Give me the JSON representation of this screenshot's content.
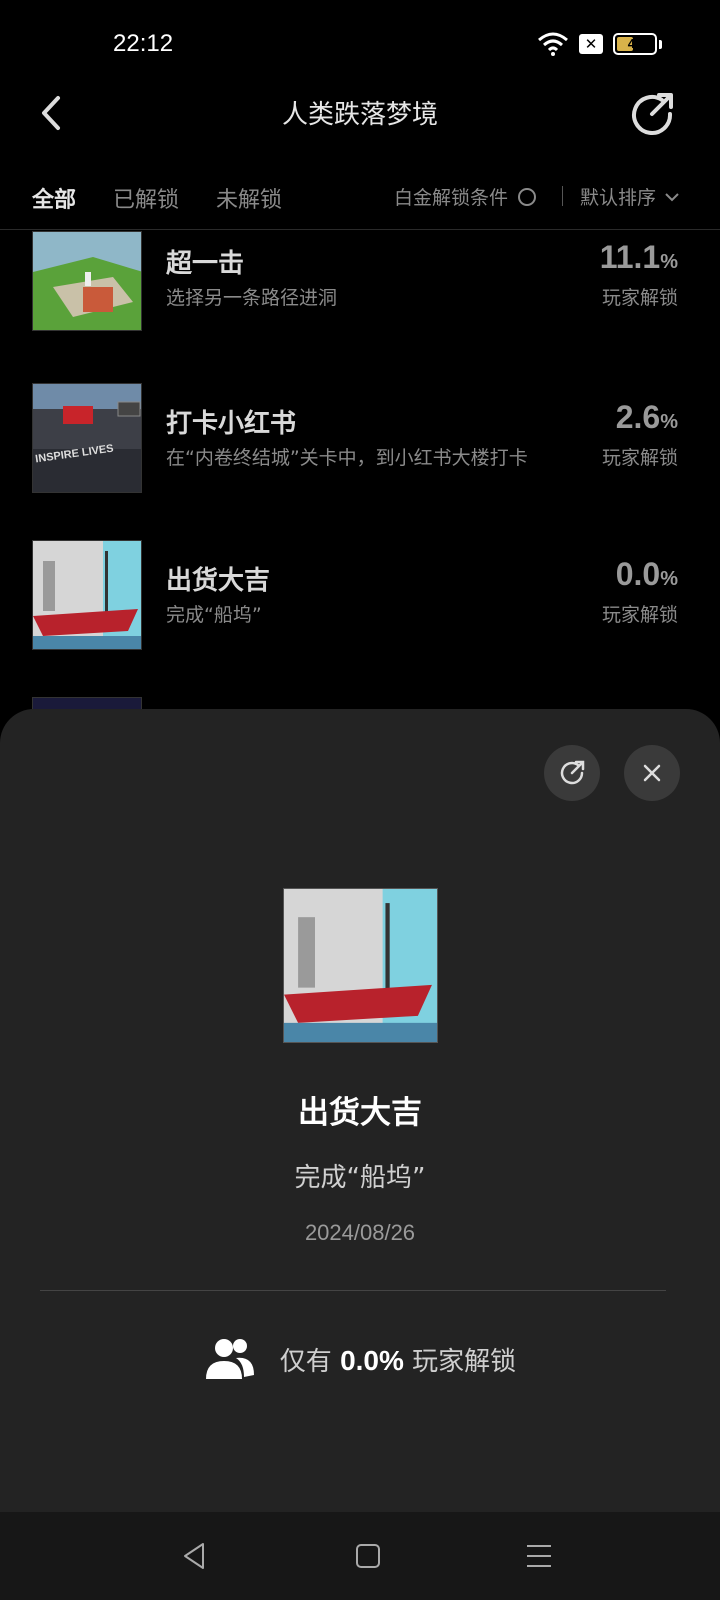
{
  "status": {
    "time": "22:12",
    "battery": "44",
    "battery_level": 0.44
  },
  "header": {
    "title": "人类跌落梦境"
  },
  "tabs": [
    {
      "label": "全部",
      "active": true
    },
    {
      "label": "已解锁",
      "active": false
    },
    {
      "label": "未解锁",
      "active": false
    }
  ],
  "filters": {
    "platinum": "白金解锁条件",
    "sort": "默认排序"
  },
  "achievements": [
    {
      "title": "超一击",
      "desc": "选择另一条路径进洞",
      "pct": "11.1",
      "pct_unit": "%",
      "sub": "玩家解锁"
    },
    {
      "title": "打卡小红书",
      "desc": "在“内卷终结城”关卡中，到小红书大楼打卡",
      "pct": "2.6",
      "pct_unit": "%",
      "sub": "玩家解锁",
      "thumb_text": "INSPIRE LIVES"
    },
    {
      "title": "出货大吉",
      "desc": "完成“船坞”",
      "pct": "0.0",
      "pct_unit": "%",
      "sub": "玩家解锁"
    }
  ],
  "detail": {
    "title": "出货大吉",
    "desc": "完成“船坞”",
    "date": "2024/08/26",
    "rarity_prefix": "仅有",
    "rarity_value": "0.0%",
    "rarity_suffix": "玩家解锁"
  },
  "colors": {
    "background": "#000000",
    "sheet": "#232323",
    "battery": "#d8b24a"
  }
}
